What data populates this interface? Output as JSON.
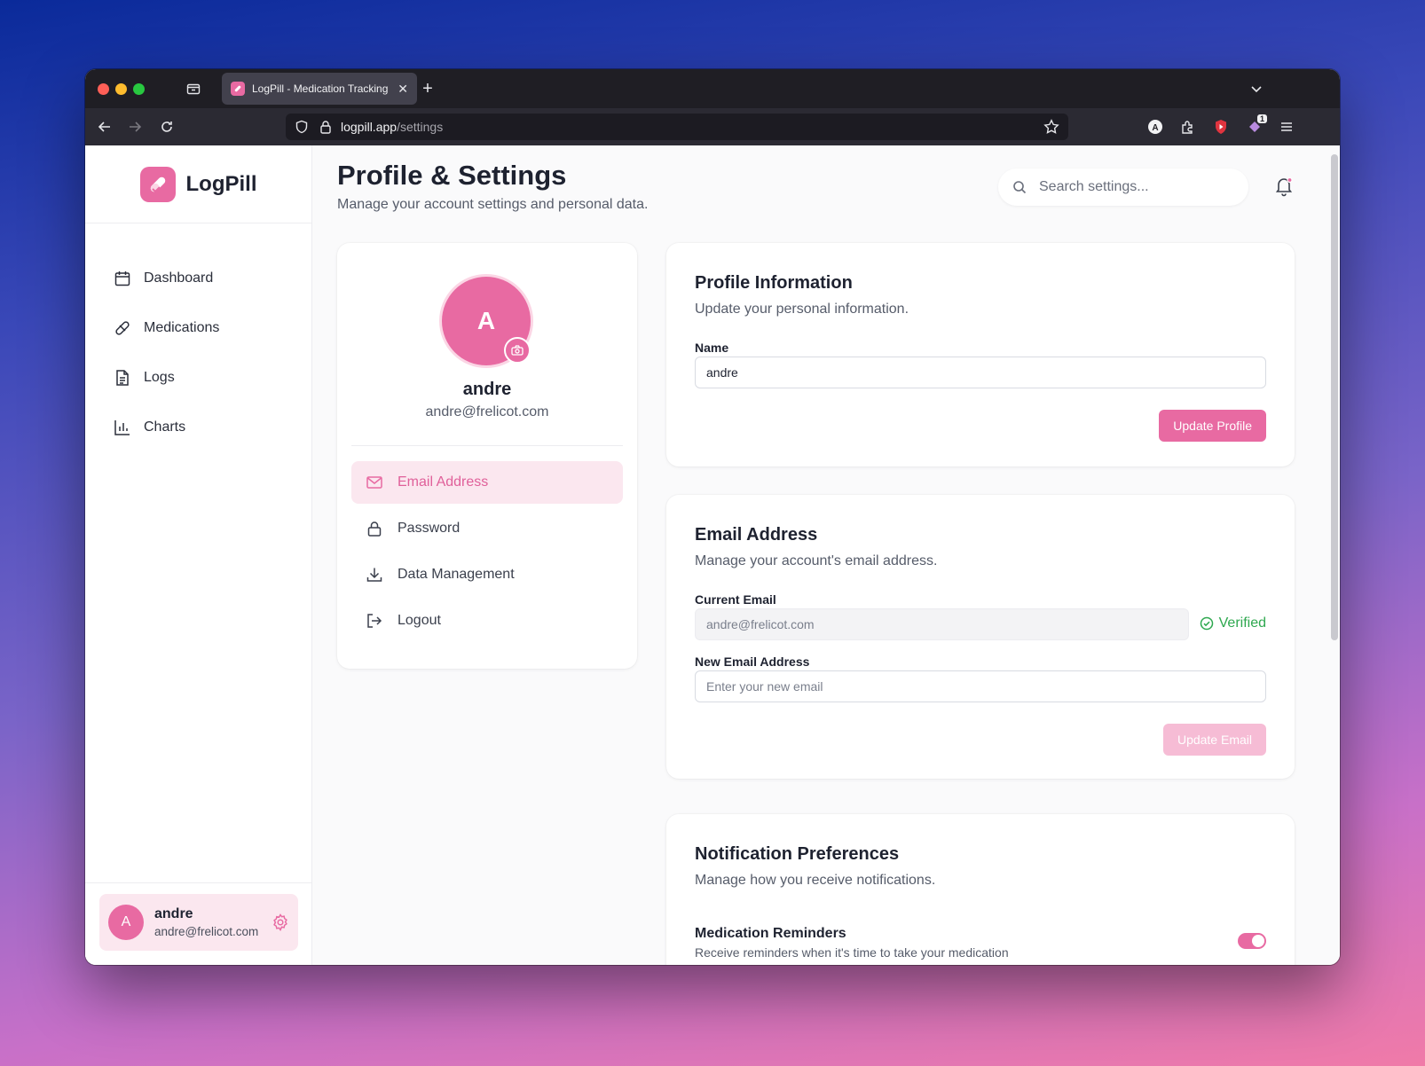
{
  "browser": {
    "tab_title": "LogPill - Medication Tracking",
    "url_domain": "logpill.app",
    "url_path": "/settings",
    "extension_badge": "1"
  },
  "sidebar": {
    "brand": "LogPill",
    "items": [
      {
        "label": "Dashboard",
        "icon": "calendar-icon"
      },
      {
        "label": "Medications",
        "icon": "pill-icon"
      },
      {
        "label": "Logs",
        "icon": "document-icon"
      },
      {
        "label": "Charts",
        "icon": "bar-chart-icon"
      }
    ],
    "user": {
      "initial": "A",
      "name": "andre",
      "email": "andre@frelicot.com"
    }
  },
  "header": {
    "title": "Profile & Settings",
    "subtitle": "Manage your account settings and personal data.",
    "search_placeholder": "Search settings..."
  },
  "profile_card": {
    "initial": "A",
    "name": "andre",
    "email": "andre@frelicot.com",
    "menu": [
      {
        "label": "Email Address",
        "icon": "mail-icon",
        "active": true
      },
      {
        "label": "Password",
        "icon": "lock-icon",
        "active": false
      },
      {
        "label": "Data Management",
        "icon": "download-icon",
        "active": false
      },
      {
        "label": "Logout",
        "icon": "logout-icon",
        "active": false
      }
    ]
  },
  "profile_info": {
    "title": "Profile Information",
    "subtitle": "Update your personal information.",
    "name_label": "Name",
    "name_value": "andre",
    "button": "Update Profile"
  },
  "email_section": {
    "title": "Email Address",
    "subtitle": "Manage your account's email address.",
    "current_label": "Current Email",
    "current_value": "andre@frelicot.com",
    "verified": "Verified",
    "new_label": "New Email Address",
    "new_placeholder": "Enter your new email",
    "button": "Update Email"
  },
  "notifications": {
    "title": "Notification Preferences",
    "subtitle": "Manage how you receive notifications.",
    "reminders_label": "Medication Reminders",
    "reminders_desc": "Receive reminders when it's time to take your medication",
    "reminders_enabled": true
  },
  "colors": {
    "accent": "#e86aa2",
    "accent_light": "#fbe7ef",
    "success": "#2ea84f"
  }
}
